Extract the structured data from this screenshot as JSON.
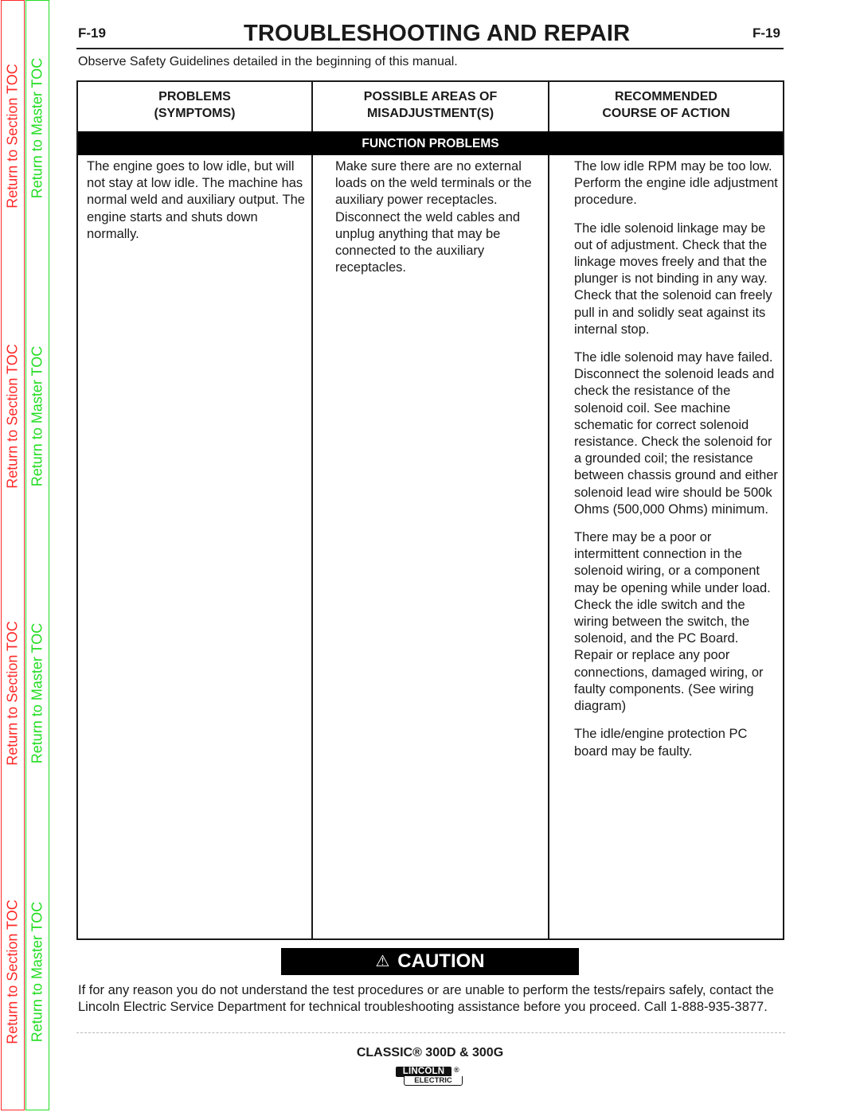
{
  "toc": {
    "section_label": "Return to Section TOC",
    "master_label": "Return to Master TOC",
    "colors": {
      "section": "#ff2a2a",
      "master": "#22dd22"
    }
  },
  "header": {
    "page_number": "F-19",
    "title": "TROUBLESHOOTING AND REPAIR",
    "safety_note": "Observe Safety Guidelines detailed in the beginning of this manual."
  },
  "table": {
    "columns": [
      {
        "line1": "PROBLEMS",
        "line2": "(SYMPTOMS)"
      },
      {
        "line1": "POSSIBLE AREAS OF",
        "line2": "MISADJUSTMENT(S)"
      },
      {
        "line1": "RECOMMENDED",
        "line2": "COURSE OF ACTION"
      }
    ],
    "section_band": "FUNCTION PROBLEMS",
    "row": {
      "problem": "The engine goes to low idle, but will not stay at low idle.  The machine has normal weld and auxiliary output.  The engine starts and shuts down normally.",
      "misadjustment": "Make sure there are no external loads on the weld terminals or the auxiliary power receptacles.  Disconnect the weld cables and unplug anything that may be connected to the auxiliary receptacles.",
      "actions": [
        "The low idle RPM may be too low. Perform the engine idle adjustment procedure.",
        "The idle solenoid linkage may be out of adjustment. Check that the linkage moves freely and that the plunger is not binding in any way.  Check that the solenoid can freely pull in and solidly seat against its internal stop.",
        "The idle solenoid may have failed.  Disconnect the solenoid leads and check the resistance of the solenoid coil.  See machine schematic for correct solenoid resistance.  Check the solenoid for a grounded coil; the resistance between chassis ground and either solenoid lead wire should be 500k Ohms (500,000 Ohms) minimum.",
        "There may be a poor or intermittent connection in the solenoid wiring, or a component may be opening while under load.  Check the idle switch and the wiring between the switch, the solenoid, and the PC Board. Repair or replace any poor connections, damaged wiring, or faulty components.  (See wiring diagram)",
        "The idle/engine protection PC board may be faulty."
      ]
    }
  },
  "caution": {
    "icon": "warning-triangle-icon",
    "label": "CAUTION",
    "text": "If for any reason you do not understand the test procedures or are unable to perform the tests/repairs safely, contact the Lincoln Electric Service Department for technical troubleshooting assistance before you proceed. Call 1-888-935-3877."
  },
  "footer": {
    "model": "CLASSIC® 300D & 300G",
    "logo_top": "LINCOLN",
    "logo_reg": "®",
    "logo_bottom": "ELECTRIC"
  }
}
